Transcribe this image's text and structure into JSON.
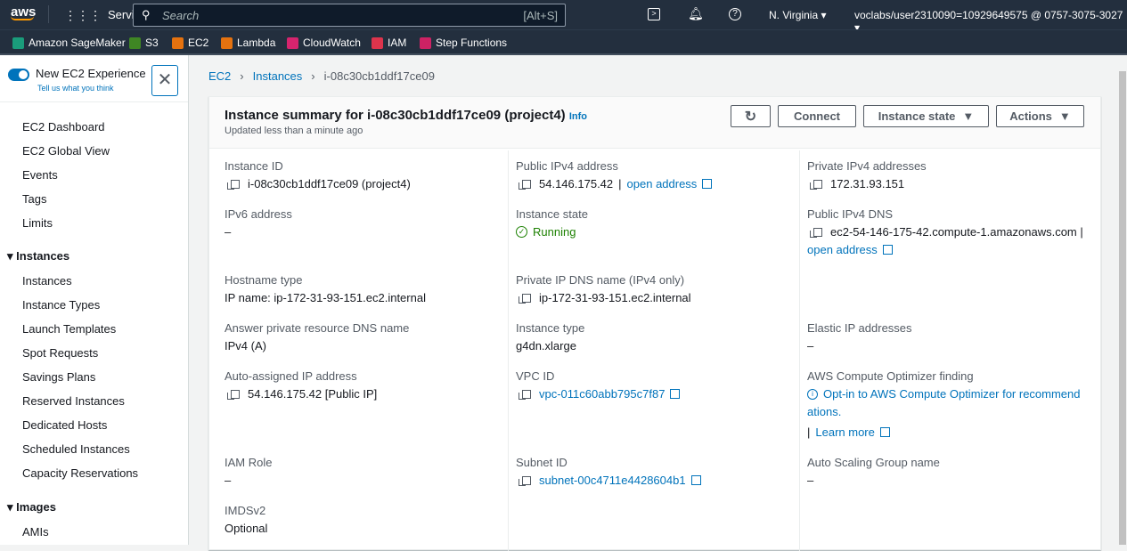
{
  "topnav": {
    "logo": "aws",
    "services": "Services",
    "search_placeholder": "Search",
    "search_shortcut": "[Alt+S]",
    "region": "N. Virginia",
    "account": "voclabs/user2310090=10929649575 @ 0757-3075-3027"
  },
  "favorites": [
    {
      "label": "Amazon SageMaker",
      "color": "#1a9c7b"
    },
    {
      "label": "S3",
      "color": "#3f8624"
    },
    {
      "label": "EC2",
      "color": "#e5720f"
    },
    {
      "label": "Lambda",
      "color": "#e5720f"
    },
    {
      "label": "CloudWatch",
      "color": "#d6246e"
    },
    {
      "label": "IAM",
      "color": "#dd344c"
    },
    {
      "label": "Step Functions",
      "color": "#cd2264"
    }
  ],
  "sidebar": {
    "toggle_label": "New EC2 Experience",
    "feedback": "Tell us what you think",
    "items": [
      "EC2 Dashboard",
      "EC2 Global View",
      "Events",
      "Tags",
      "Limits"
    ],
    "sections": [
      {
        "title": "Instances",
        "items": [
          "Instances",
          "Instance Types",
          "Launch Templates",
          "Spot Requests",
          "Savings Plans",
          "Reserved Instances",
          "Dedicated Hosts",
          "Scheduled Instances",
          "Capacity Reservations"
        ]
      },
      {
        "title": "Images",
        "items": [
          "AMIs"
        ]
      }
    ]
  },
  "breadcrumb": [
    "EC2",
    "Instances",
    "i-08c30cb1ddf17ce09"
  ],
  "summary": {
    "title": "Instance summary for i-08c30cb1ddf17ce09 (project4)",
    "info": "Info",
    "updated": "Updated less than a minute ago",
    "buttons": {
      "connect": "Connect",
      "state": "Instance state",
      "actions": "Actions"
    }
  },
  "fields": {
    "instance_id": {
      "label": "Instance ID",
      "value": "i-08c30cb1ddf17ce09 (project4)"
    },
    "public_ipv4": {
      "label": "Public IPv4 address",
      "value": "54.146.175.42",
      "link": "open address"
    },
    "private_ipv4": {
      "label": "Private IPv4 addresses",
      "value": "172.31.93.151"
    },
    "ipv6": {
      "label": "IPv6 address",
      "value": "–"
    },
    "state": {
      "label": "Instance state",
      "value": "Running",
      "color": "#1d8102"
    },
    "public_dns": {
      "label": "Public IPv4 DNS",
      "value": "ec2-54-146-175-42.compute-1.amazonaws.com |",
      "link": "open address"
    },
    "hostname": {
      "label": "Hostname type",
      "value": "IP name: ip-172-31-93-151.ec2.internal"
    },
    "private_dns": {
      "label": "Private IP DNS name (IPv4 only)",
      "value": "ip-172-31-93-151.ec2.internal"
    },
    "answer_dns": {
      "label": "Answer private resource DNS name",
      "value": "IPv4 (A)"
    },
    "type": {
      "label": "Instance type",
      "value": "g4dn.xlarge"
    },
    "elastic": {
      "label": "Elastic IP addresses",
      "value": "–"
    },
    "auto_ip": {
      "label": "Auto-assigned IP address",
      "value": "54.146.175.42 [Public IP]"
    },
    "vpc": {
      "label": "VPC ID",
      "value": "vpc-011c60abb795c7f87"
    },
    "optimizer": {
      "label": "AWS Compute Optimizer finding",
      "line1": "Opt-in to AWS Compute Optimizer for recommend",
      "line2": "ations.",
      "learn": "Learn more"
    },
    "iam": {
      "label": "IAM Role",
      "value": "–"
    },
    "subnet": {
      "label": "Subnet ID",
      "value": "subnet-00c4711e4428604b1"
    },
    "asg": {
      "label": "Auto Scaling Group name",
      "value": "–"
    },
    "imds": {
      "label": "IMDSv2",
      "value": "Optional"
    }
  }
}
